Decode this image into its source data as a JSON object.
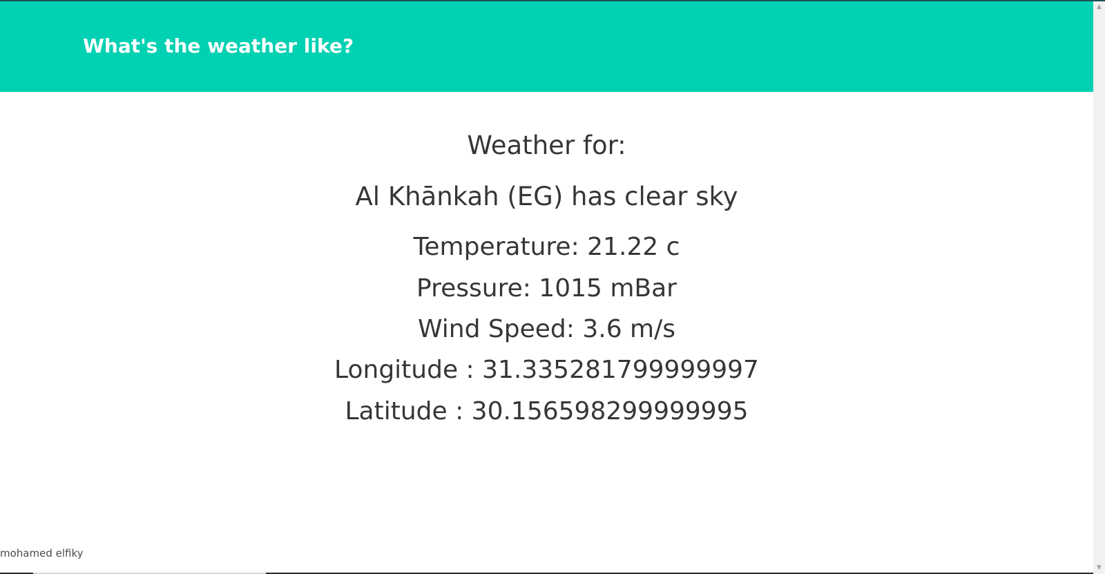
{
  "header": {
    "title": "What's the weather like?"
  },
  "weather": {
    "heading": "Weather for:",
    "summary": "Al Khānkah (EG) has clear sky",
    "temperature": "Temperature: 21.22 c",
    "pressure": "Pressure: 1015 mBar",
    "wind_speed": "Wind Speed: 3.6 m/s",
    "longitude": "Longitude : 31.335281799999997",
    "latitude": "Latitude : 30.156598299999995"
  },
  "footer": {
    "author": "mohamed elfiky"
  },
  "scrollbar": {
    "up_icon": "▲",
    "down_icon": "▼"
  },
  "colors": {
    "hero_background": "#00d1b2",
    "hero_text": "#ffffff",
    "body_text": "#363636"
  }
}
